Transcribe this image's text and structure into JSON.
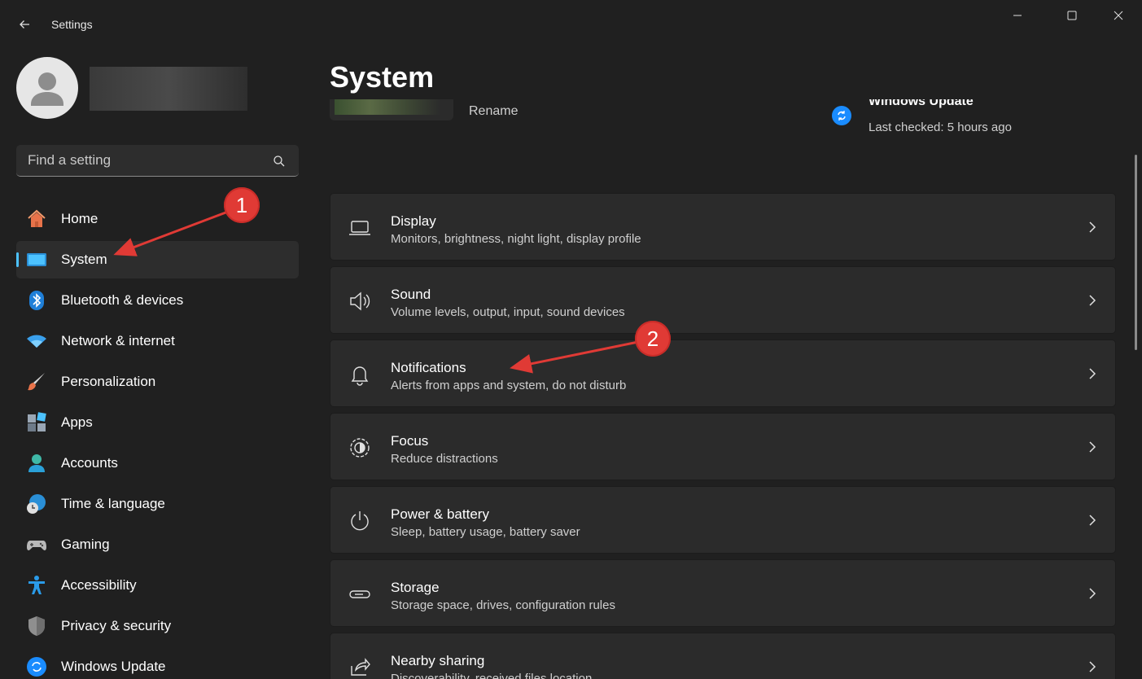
{
  "window": {
    "title": "Settings"
  },
  "sidebar": {
    "search_placeholder": "Find a setting",
    "items": [
      {
        "label": "Home",
        "icon": "home-icon"
      },
      {
        "label": "System",
        "icon": "system-icon",
        "active": true
      },
      {
        "label": "Bluetooth & devices",
        "icon": "bluetooth-icon"
      },
      {
        "label": "Network & internet",
        "icon": "wifi-icon"
      },
      {
        "label": "Personalization",
        "icon": "brush-icon"
      },
      {
        "label": "Apps",
        "icon": "apps-icon"
      },
      {
        "label": "Accounts",
        "icon": "accounts-icon"
      },
      {
        "label": "Time & language",
        "icon": "globe-clock-icon"
      },
      {
        "label": "Gaming",
        "icon": "gamepad-icon"
      },
      {
        "label": "Accessibility",
        "icon": "accessibility-icon"
      },
      {
        "label": "Privacy & security",
        "icon": "shield-icon"
      },
      {
        "label": "Windows Update",
        "icon": "update-icon"
      }
    ]
  },
  "main": {
    "page_title": "System",
    "device": {
      "rename_label": "Rename"
    },
    "windows_update": {
      "title": "Windows Update",
      "subtitle": "Last checked: 5 hours ago"
    },
    "cards": [
      {
        "title": "Display",
        "subtitle": "Monitors, brightness, night light, display profile",
        "icon": "laptop-icon"
      },
      {
        "title": "Sound",
        "subtitle": "Volume levels, output, input, sound devices",
        "icon": "speaker-icon"
      },
      {
        "title": "Notifications",
        "subtitle": "Alerts from apps and system, do not disturb",
        "icon": "bell-icon"
      },
      {
        "title": "Focus",
        "subtitle": "Reduce distractions",
        "icon": "focus-icon"
      },
      {
        "title": "Power & battery",
        "subtitle": "Sleep, battery usage, battery saver",
        "icon": "power-icon"
      },
      {
        "title": "Storage",
        "subtitle": "Storage space, drives, configuration rules",
        "icon": "storage-icon"
      },
      {
        "title": "Nearby sharing",
        "subtitle": "Discoverability, received files location",
        "icon": "share-icon"
      }
    ]
  },
  "annotations": {
    "badge_1": "1",
    "badge_2": "2"
  },
  "colors": {
    "background": "#202020",
    "card": "#2b2b2b",
    "accent": "#4cc2ff",
    "annotation": "#e03a35"
  }
}
